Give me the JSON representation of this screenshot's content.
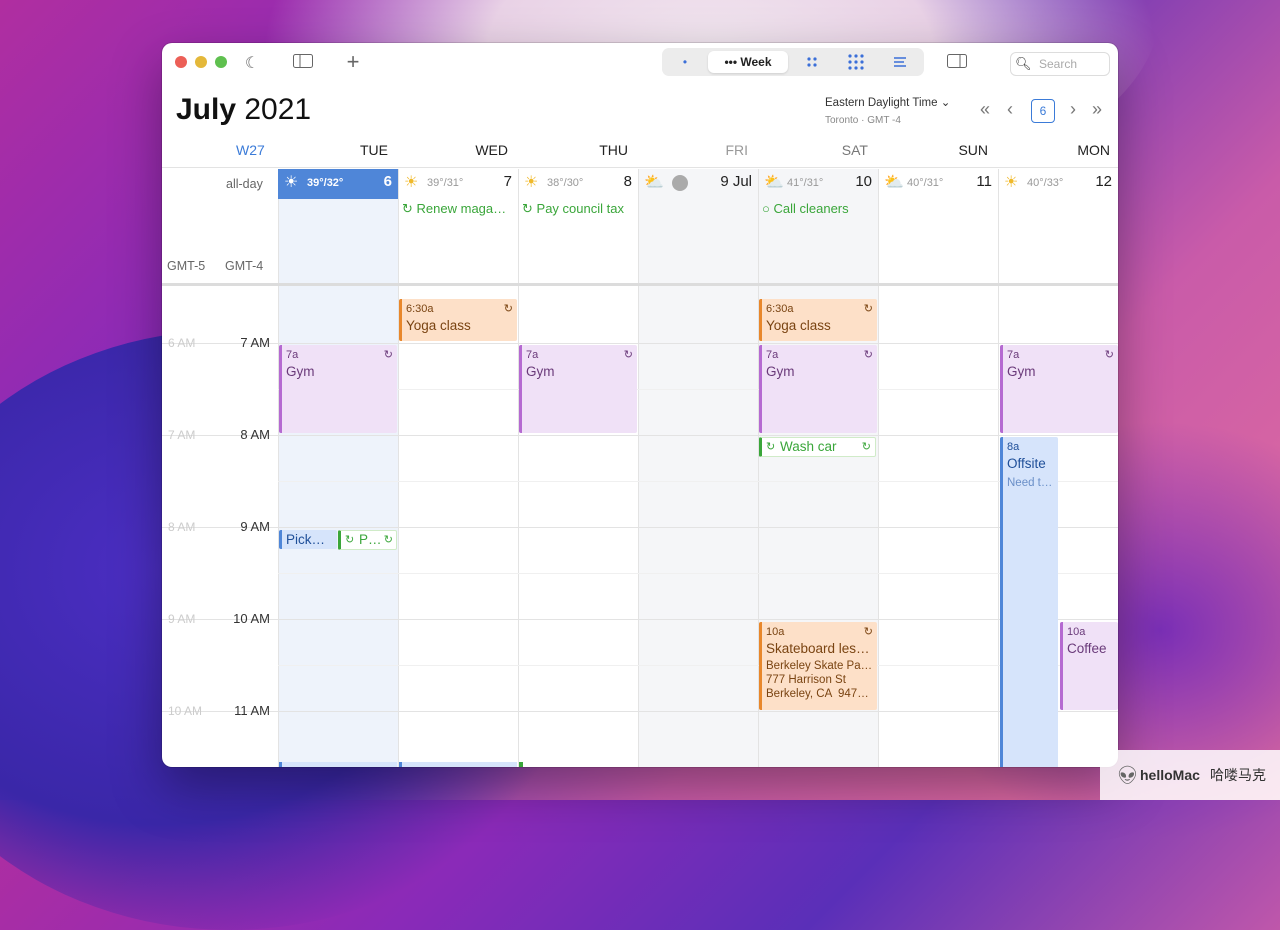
{
  "toolbar": {
    "view_day_label": "•",
    "view_week_label": "••• Week",
    "search_placeholder": "Search"
  },
  "header": {
    "month": "July",
    "year": "2021",
    "timezone": "Eastern Daylight Time",
    "timezone_sub": "Toronto · GMT -4",
    "today_number": "6",
    "week_label": "W27"
  },
  "days": [
    {
      "name": "TUE",
      "num": "6",
      "temp": "39°/32°",
      "wx": "☀",
      "event": ""
    },
    {
      "name": "WED",
      "num": "7",
      "temp": "39°/31°",
      "wx": "☀",
      "event": "Renew maga…"
    },
    {
      "name": "THU",
      "num": "8",
      "temp": "38°/30°",
      "wx": "☀",
      "event": "Pay council tax"
    },
    {
      "name": "FRI",
      "num": "9 Jul",
      "temp": "",
      "wx": "⛅",
      "event": ""
    },
    {
      "name": "SAT",
      "num": "10",
      "temp": "41°/31°",
      "wx": "⛅",
      "event": "Call cleaners"
    },
    {
      "name": "SUN",
      "num": "11",
      "temp": "40°/31°",
      "wx": "⛅",
      "event": ""
    },
    {
      "name": "MON",
      "num": "12",
      "temp": "40°/33°",
      "wx": "☀",
      "event": ""
    }
  ],
  "allday_label": "all-day",
  "gmt5_label": "GMT-5",
  "gmt4_label": "GMT-4",
  "times_main": [
    "7 AM",
    "8 AM",
    "9 AM",
    "10 AM",
    "11 AM"
  ],
  "times_alt": [
    "6 AM",
    "7 AM",
    "8 AM",
    "9 AM",
    "10 AM"
  ],
  "events": {
    "yoga_wed": {
      "time": "6:30a",
      "name": "Yoga class"
    },
    "yoga_sat": {
      "time": "6:30a",
      "name": "Yoga class"
    },
    "gym_tue": {
      "time": "7a",
      "name": "Gym"
    },
    "gym_thu": {
      "time": "7a",
      "name": "Gym"
    },
    "gym_sat": {
      "time": "7a",
      "name": "Gym"
    },
    "gym_mon": {
      "time": "7a",
      "name": "Gym"
    },
    "wash_car": {
      "name": "Wash car"
    },
    "offsite": {
      "time": "8a",
      "name": "Offsite",
      "note": "Need t…"
    },
    "pick": {
      "name": "Pick…"
    },
    "p": {
      "name": "P…"
    },
    "skate": {
      "time": "10a",
      "name": "Skateboard les…",
      "loc1": "Berkeley Skate Pa…",
      "loc2": "777 Harrison St",
      "loc3": "Berkeley, CA  947…"
    },
    "coffee": {
      "time": "10a",
      "name": "Coffee"
    }
  },
  "watermark": {
    "brand": "helloMac",
    "cn": "哈喽马克"
  }
}
